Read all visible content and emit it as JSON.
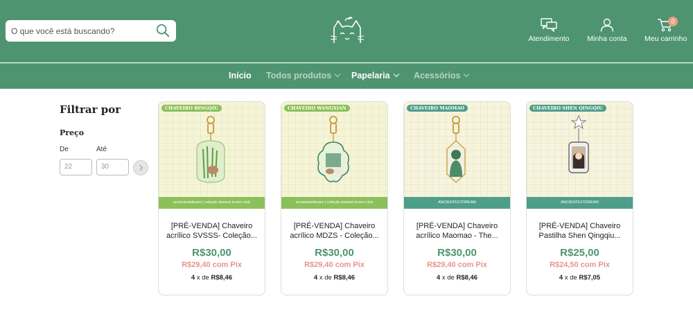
{
  "header": {
    "search_placeholder": "O que você está buscando?",
    "atendimento_label": "Atendimento",
    "conta_label": "Minha conta",
    "carrinho_label": "Meu carrinho",
    "cart_count": "0"
  },
  "nav": {
    "items": [
      {
        "label": "Início",
        "dropdown": false
      },
      {
        "label": "Todos produtos",
        "dropdown": true
      },
      {
        "label": "Papelaria",
        "dropdown": true
      },
      {
        "label": "Acessórios",
        "dropdown": true
      }
    ]
  },
  "filter": {
    "title": "Filtrar por",
    "price_title": "Preço",
    "from_label": "De",
    "to_label": "Até",
    "from_value": "22",
    "to_value": "30"
  },
  "products": [
    {
      "tag": "CHAVEIRO BINGQIU",
      "footer": "ancientestdream | coleção danmei lovers club",
      "name": "[PRÉ-VENDA] Chaveiro acrílico SVSSS- Coleção...",
      "price": "R$30,00",
      "pix": "R$29,40 com Pix",
      "inst_n": "4",
      "inst_x": "x de",
      "inst_v": "R$8,46"
    },
    {
      "tag": "CHAVEIRO WANGXIAN",
      "footer": "ancientestdream | coleção danmei lovers club",
      "name": "[PRÉ-VENDA] Chaveiro acrílico MDZS - Coleção...",
      "price": "R$30,00",
      "pix": "R$29,40 com Pix",
      "inst_n": "4",
      "inst_x": "x de",
      "inst_v": "R$8,46"
    },
    {
      "tag": "CHAVEIRO MAOMAO",
      "footer": "ANCIENTESTDREAM",
      "name": "[PRÉ-VENDA] Chaveiro acrílico Maomao - The...",
      "price": "R$30,00",
      "pix": "R$29,40 com Pix",
      "inst_n": "4",
      "inst_x": "x de",
      "inst_v": "R$8,46"
    },
    {
      "tag": "CHAVEIRO SHEN QINGQIU",
      "footer": "ANCIENTESTDREAM",
      "name": "[PRÉ-VENDA] Chaveiro Pastilha Shen Qingqiu...",
      "price": "R$25,00",
      "pix": "R$24,50 com Pix",
      "inst_n": "4",
      "inst_x": "x de",
      "inst_v": "R$7,05"
    }
  ],
  "colors": {
    "brand": "#4e9470",
    "pix": "#e8938c",
    "badge": "#e8a083",
    "tag_green": "#8cc05a",
    "tag_teal": "#4e9e8a"
  },
  "icons": [
    "search-icon",
    "cat-logo-icon",
    "chat-icon",
    "user-icon",
    "cart-icon",
    "chevron-down-icon",
    "chevron-right-icon"
  ]
}
